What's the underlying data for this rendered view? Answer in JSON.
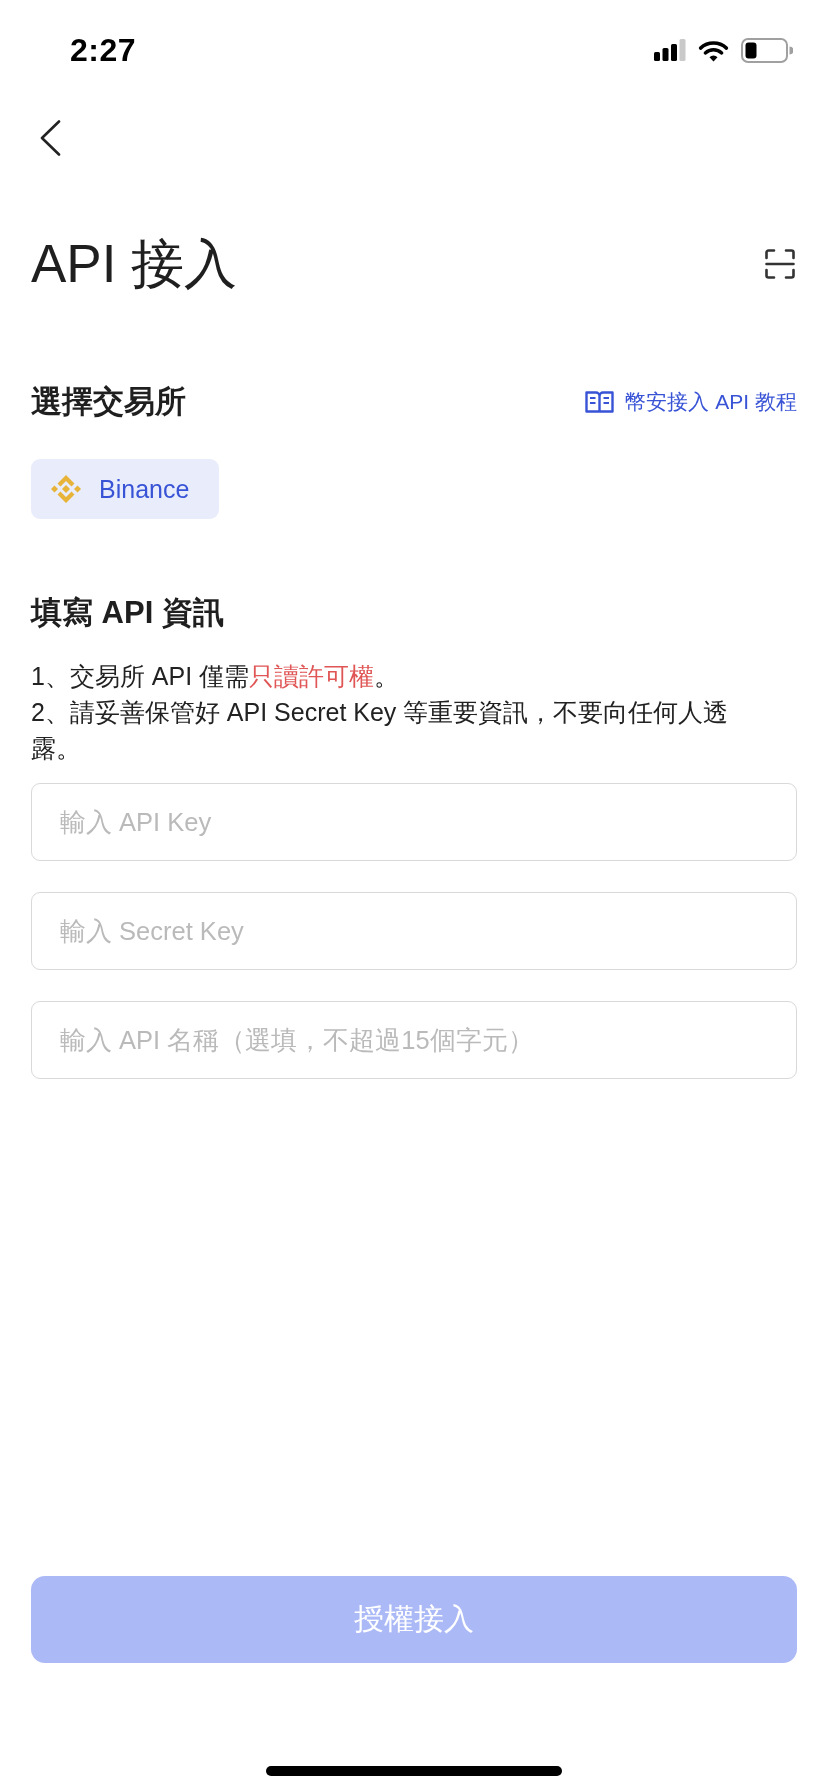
{
  "status_bar": {
    "time": "2:27"
  },
  "nav": {
    "title": "API 接入"
  },
  "exchange_section": {
    "heading": "選擇交易所",
    "tutorial_link": "幣安接入 API 教程",
    "exchanges": [
      {
        "name": "Binance",
        "selected": true
      }
    ]
  },
  "api_section": {
    "heading": "填寫 API 資訊",
    "notes": [
      {
        "parts": [
          {
            "text": "1、交易所 API 僅需",
            "highlight": false
          },
          {
            "text": "只讀許可權",
            "highlight": true
          },
          {
            "text": "。",
            "highlight": false
          }
        ]
      },
      {
        "parts": [
          {
            "text": "2、請妥善保管好 API Secret Key 等重要資訊，不要向任何人透露。",
            "highlight": false
          }
        ]
      }
    ],
    "fields": [
      {
        "placeholder": "輸入 API Key"
      },
      {
        "placeholder": "輸入 Secret Key"
      },
      {
        "placeholder": "輸入 API 名稱（選填，不超過15個字元）"
      }
    ]
  },
  "submit_button": {
    "label": "授權接入",
    "disabled": true
  }
}
